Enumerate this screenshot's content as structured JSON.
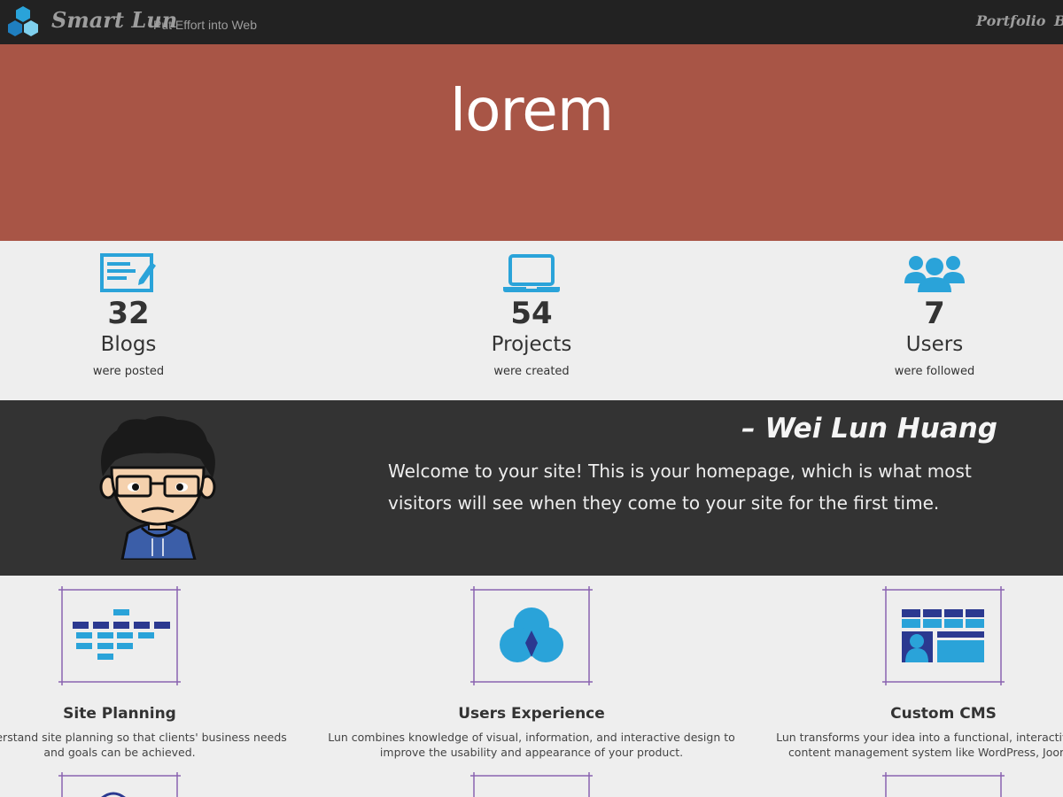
{
  "navbar": {
    "logo_icon": "hexagon-cluster-icon",
    "brand": "Smart Lun",
    "tagline": "Put Effort into Web",
    "links": [
      "Portfolio",
      "B"
    ]
  },
  "hero": {
    "title": "lorem",
    "background": "#a85546"
  },
  "stats": [
    {
      "icon": "document-edit-icon",
      "number": "32",
      "label": "Blogs",
      "sub": "were posted"
    },
    {
      "icon": "laptop-icon",
      "number": "54",
      "label": "Projects",
      "sub": "were created"
    },
    {
      "icon": "users-icon",
      "number": "7",
      "label": "Users",
      "sub": "were followed"
    }
  ],
  "quote": {
    "author": "– Wei Lun Huang",
    "text": "Welcome to your site! This is your homepage, which is what most visitors will see when they come to your site for the first time."
  },
  "services": [
    {
      "icon": "sitemap-icon",
      "title": "Site Planning",
      "desc_line1": "t to understand site planning so that clients' business needs",
      "desc_line2": "and goals can be achieved."
    },
    {
      "icon": "venn-diagram-icon",
      "title": "Users Experience",
      "desc_line1": "Lun combines knowledge of visual, information, and interactive design to",
      "desc_line2": "improve the usability and appearance of your product."
    },
    {
      "icon": "cms-layout-icon",
      "title": "Custom CMS",
      "desc_line1": "Lun transforms your idea into a functional, interactive websi",
      "desc_line2": "content management system like WordPress, Joomla, ar"
    }
  ],
  "colors": {
    "navbar": "#222222",
    "accent_blue": "#2aa3d9",
    "dark_section": "#333333"
  }
}
